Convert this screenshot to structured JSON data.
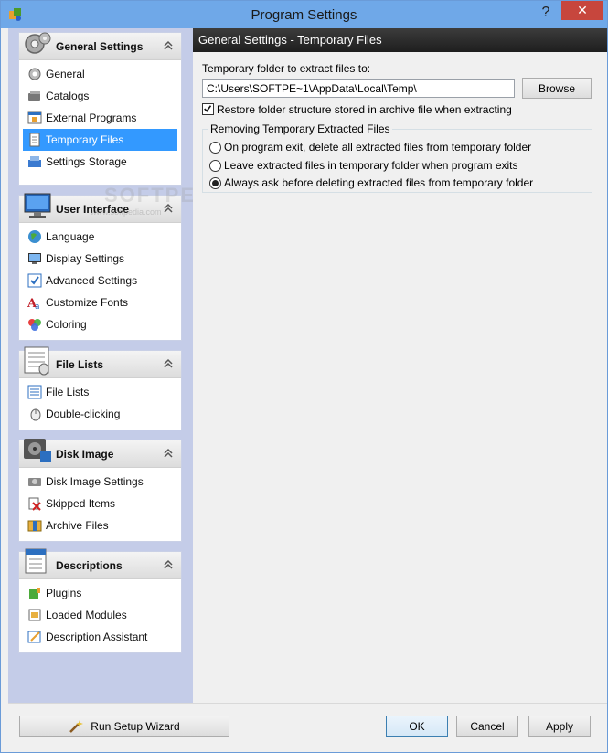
{
  "window": {
    "title": "Program Settings",
    "help_glyph": "?",
    "close_glyph": "✕"
  },
  "sidebar": {
    "groups": [
      {
        "title": "General Settings",
        "icon": "gears-icon",
        "items": [
          {
            "label": "General",
            "icon": "gear-icon"
          },
          {
            "label": "Catalogs",
            "icon": "catalogs-icon"
          },
          {
            "label": "External Programs",
            "icon": "external-programs-icon"
          },
          {
            "label": "Temporary Files",
            "icon": "temporary-files-icon",
            "selected": true
          },
          {
            "label": "Settings Storage",
            "icon": "settings-storage-icon"
          }
        ]
      },
      {
        "title": "User Interface",
        "icon": "monitor-icon",
        "items": [
          {
            "label": "Language",
            "icon": "globe-icon"
          },
          {
            "label": "Display Settings",
            "icon": "display-icon"
          },
          {
            "label": "Advanced Settings",
            "icon": "checklist-icon"
          },
          {
            "label": "Customize Fonts",
            "icon": "font-icon"
          },
          {
            "label": "Coloring",
            "icon": "palette-icon"
          }
        ]
      },
      {
        "title": "File Lists",
        "icon": "file-list-icon",
        "items": [
          {
            "label": "File Lists",
            "icon": "list-icon"
          },
          {
            "label": "Double-clicking",
            "icon": "mouse-icon"
          }
        ]
      },
      {
        "title": "Disk Image",
        "icon": "disk-image-icon",
        "items": [
          {
            "label": "Disk Image Settings",
            "icon": "disk-icon"
          },
          {
            "label": "Skipped Items",
            "icon": "skipped-icon"
          },
          {
            "label": "Archive Files",
            "icon": "archive-icon"
          }
        ]
      },
      {
        "title": "Descriptions",
        "icon": "descriptions-icon",
        "items": [
          {
            "label": "Plugins",
            "icon": "plugin-icon"
          },
          {
            "label": "Loaded Modules",
            "icon": "modules-icon"
          },
          {
            "label": "Description Assistant",
            "icon": "assistant-icon"
          }
        ]
      }
    ]
  },
  "content": {
    "header": "General Settings - Temporary Files",
    "folder_label": "Temporary folder to extract files to:",
    "folder_value": "C:\\Users\\SOFTPE~1\\AppData\\Local\\Temp\\",
    "browse_label": "Browse",
    "restore_checkbox_label": "Restore folder structure stored in archive file when extracting",
    "restore_checked": true,
    "removing_group_label": "Removing Temporary Extracted Files",
    "radio_options": [
      {
        "label": "On program exit, delete all extracted files from temporary folder",
        "selected": false
      },
      {
        "label": "Leave extracted files in temporary folder when program exits",
        "selected": false
      },
      {
        "label": "Always ask before deleting extracted files from temporary folder",
        "selected": true
      }
    ]
  },
  "footer": {
    "wizard_label": "Run Setup Wizard",
    "ok_label": "OK",
    "cancel_label": "Cancel",
    "apply_label": "Apply"
  },
  "watermark": {
    "text": "SOFTPEDIA",
    "url": "www.softpedia.com"
  },
  "colors": {
    "titlebar": "#6fa8e8",
    "selection": "#3399ff",
    "sidebar_bg": "#c4cce8",
    "close": "#c7463d"
  }
}
